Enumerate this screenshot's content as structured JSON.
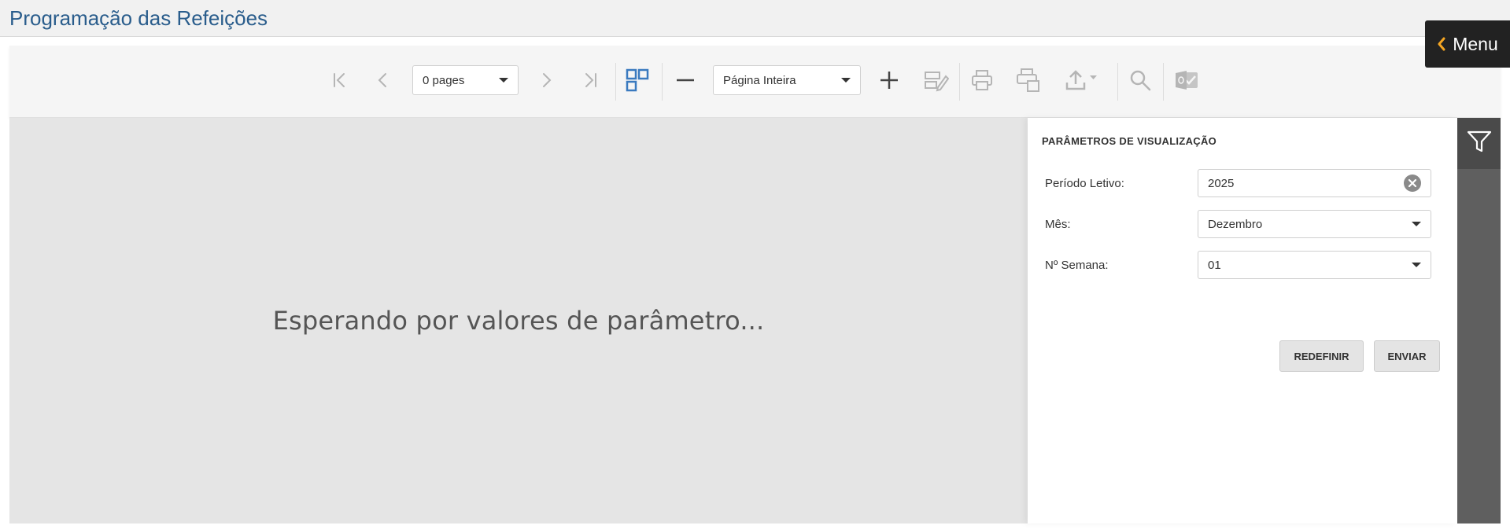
{
  "page": {
    "title": "Programação das Refeições"
  },
  "menu": {
    "label": "Menu",
    "icon": "chevron-left-icon"
  },
  "toolbar": {
    "page_select": {
      "value": "0 pages"
    },
    "zoom_select": {
      "value": "Página Inteira"
    },
    "icons": [
      "first-page-icon",
      "previous-page-icon",
      "next-page-icon",
      "last-page-icon",
      "multipage-icon",
      "zoom-out-icon",
      "zoom-in-icon",
      "edit-fields-icon",
      "print-icon",
      "print-page-icon",
      "export-icon",
      "search-icon",
      "outlook-icon"
    ]
  },
  "viewer": {
    "message": "Esperando por valores de parâmetro..."
  },
  "params": {
    "title": "PARÂMETROS DE VISUALIZAÇÃO",
    "fields": [
      {
        "label": "Período Letivo:",
        "value": "2025"
      },
      {
        "label": "Mês:",
        "value": "Dezembro"
      },
      {
        "label": "Nº Semana:",
        "value": "01"
      }
    ],
    "reset_label": "REDEFINIR",
    "submit_label": "ENVIAR"
  },
  "colors": {
    "title_blue": "#2a5d8c",
    "accent_blue": "#3a7abf",
    "menu_bg": "#222222",
    "menu_chevron": "#f5a623",
    "rail_bg": "#5f5f5f",
    "disabled_icon": "#b5b5b5"
  }
}
